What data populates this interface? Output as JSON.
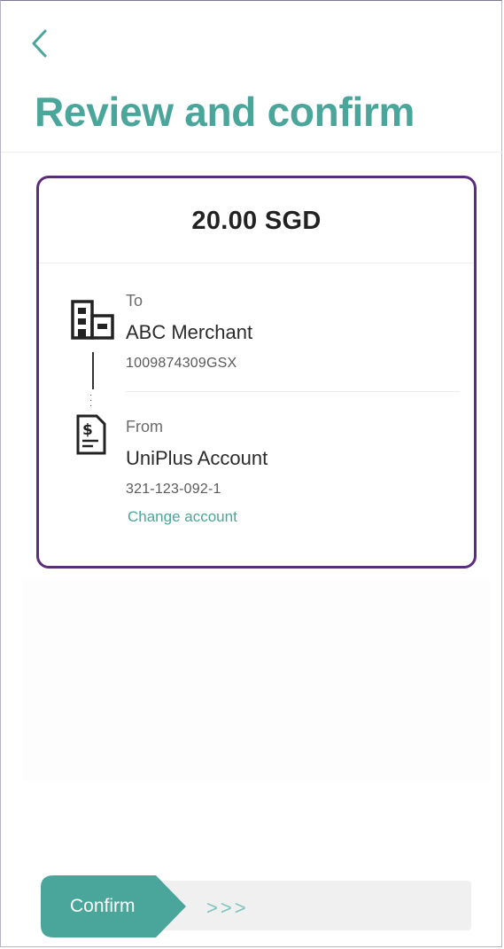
{
  "header": {
    "back_icon": "chevron-left-icon",
    "title": "Review and confirm"
  },
  "summary": {
    "amount": "20.00 SGD"
  },
  "to": {
    "icon": "building-icon",
    "label": "To",
    "name": "ABC Merchant",
    "id": "1009874309GSX"
  },
  "from": {
    "icon": "account-document-icon",
    "label": "From",
    "name": "UniPlus Account",
    "number": "321-123-092-1",
    "change_label": "Change account"
  },
  "slider": {
    "label": "Confirm",
    "arrows": ">>>"
  },
  "colors": {
    "accent": "#4aa59b",
    "card_border": "#5b2d7a",
    "track": "#f0f0f0"
  }
}
